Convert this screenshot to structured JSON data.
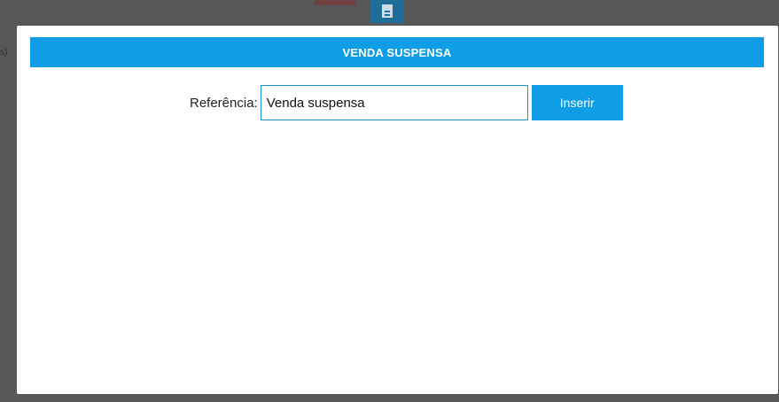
{
  "background": {
    "left_fragment": "s)",
    "top_icon": "document-icon"
  },
  "modal": {
    "title": "VENDA SUSPENSA",
    "reference_label": "Referência:",
    "reference_value": "Venda suspensa",
    "insert_button_label": "Inserir"
  },
  "colors": {
    "accent": "#0f9ee5",
    "overlay": "#575757",
    "input_border": "#1c8fd4"
  }
}
